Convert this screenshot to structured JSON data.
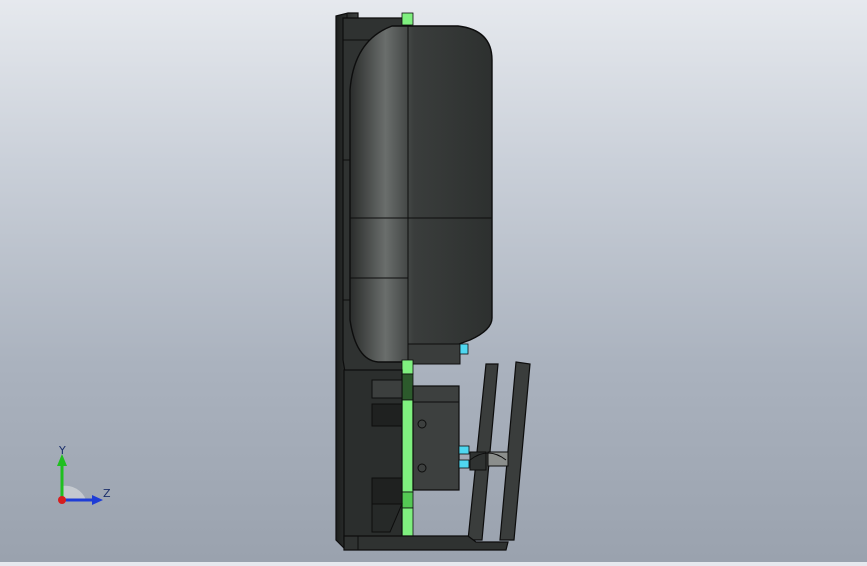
{
  "triad": {
    "y_label": "Y",
    "z_label": "Z",
    "y_color": "#1fbf1f",
    "z_color": "#1e3cd6",
    "x_color": "#d61e1e"
  },
  "colors": {
    "background_top": "#e6e9ee",
    "background_bottom": "#9aa2ae",
    "body": "#3a3d3c",
    "edge": "#111111",
    "pcb": "#7ff07f",
    "connector": "#4fd7f0"
  }
}
